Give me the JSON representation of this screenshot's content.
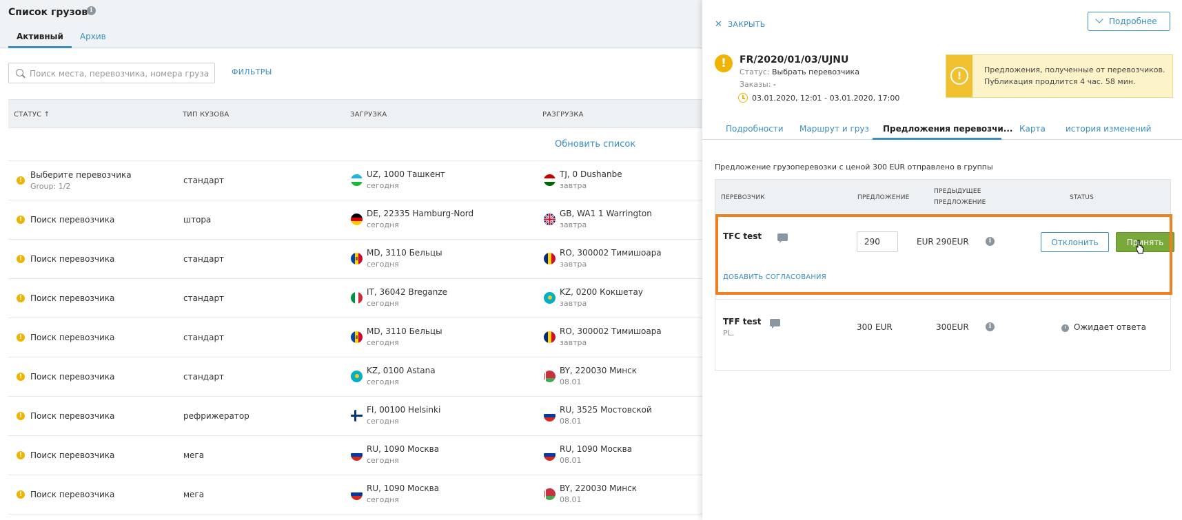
{
  "page": {
    "title": "Список грузов",
    "tabs": [
      {
        "label": "Активный",
        "active": true
      },
      {
        "label": "Архив",
        "active": false
      }
    ],
    "search_placeholder": "Поиск места, перевозчика, номера груза ...",
    "filters_label": "ФИЛЬТРЫ",
    "refresh_label": "Обновить список",
    "columns": {
      "status": "СТАТУС ↑",
      "body_type": "ТИП КУЗОВА",
      "loading": "ЗАГРУЗКА",
      "unloading": "РАЗГРУЗКА"
    },
    "rows": [
      {
        "status": "Выберите перевозчика",
        "status_sub": "Group: 1/2",
        "body": "стандарт",
        "load": "UZ, 1000 Ташкент",
        "load_day": "сегодня",
        "load_flag": "uz",
        "unload": "TJ, 0 Dushanbe",
        "unload_day": "завтра",
        "unload_flag": "tj"
      },
      {
        "status": "Поиск перевозчика",
        "status_sub": "",
        "body": "штора",
        "load": "DE, 22335 Hamburg-Nord",
        "load_day": "сегодня",
        "load_flag": "de",
        "unload": "GB, WA1 1 Warrington",
        "unload_day": "завтра",
        "unload_flag": "gb"
      },
      {
        "status": "Поиск перевозчика",
        "status_sub": "",
        "body": "стандарт",
        "load": "MD, 3110 Бельцы",
        "load_day": "сегодня",
        "load_flag": "md",
        "unload": "RO, 300002 Тимишоара",
        "unload_day": "завтра",
        "unload_flag": "ro"
      },
      {
        "status": "Поиск перевозчика",
        "status_sub": "",
        "body": "стандарт",
        "load": "IT, 36042 Breganze",
        "load_day": "сегодня",
        "load_flag": "it",
        "unload": "KZ, 0200 Кокшетау",
        "unload_day": "завтра",
        "unload_flag": "kz"
      },
      {
        "status": "Поиск перевозчика",
        "status_sub": "",
        "body": "стандарт",
        "load": "MD, 3110 Бельцы",
        "load_day": "сегодня",
        "load_flag": "md",
        "unload": "RO, 300002 Тимишоара",
        "unload_day": "завтра",
        "unload_flag": "ro"
      },
      {
        "status": "Поиск перевозчика",
        "status_sub": "",
        "body": "стандарт",
        "load": "KZ, 0100 Astana",
        "load_day": "сегодня",
        "load_flag": "kz",
        "unload": "BY, 220030 Минск",
        "unload_day": "08.01",
        "unload_flag": "by"
      },
      {
        "status": "Поиск перевозчика",
        "status_sub": "",
        "body": "рефрижератор",
        "load": "FI, 00100 Helsinki",
        "load_day": "сегодня",
        "load_flag": "fi",
        "unload": "RU, 3525 Мостовской",
        "unload_day": "08.01",
        "unload_flag": "ru"
      },
      {
        "status": "Поиск перевозчика",
        "status_sub": "",
        "body": "мега",
        "load": "RU, 1090 Москва",
        "load_day": "сегодня",
        "load_flag": "ru",
        "unload": "RU, 1090 Москва",
        "unload_day": "08.01",
        "unload_flag": "ru"
      },
      {
        "status": "Поиск перевозчика",
        "status_sub": "",
        "body": "мега",
        "load": "RU, 1090 Москва",
        "load_day": "сегодня",
        "load_flag": "ru",
        "unload": "BY, 220030 Минск",
        "unload_day": "08.01",
        "unload_flag": "by"
      }
    ]
  },
  "panel": {
    "close_label": "ЗАКРЫТЬ",
    "more_label": "Подробнее",
    "cargo_id": "FR/2020/01/03/UJNU",
    "status_key": "Статус:",
    "status_value": "Выбрать перевозчика",
    "orders_key": "Заказы:",
    "orders_value": "-",
    "dates": "03.01.2020, 12:01 - 03.01.2020, 17:00",
    "notice_line1": "Предложения, полученные от перевозчиков.",
    "notice_line2": "Публикация продлится 4 час. 58 мин.",
    "tabs": [
      "Подробности",
      "Маршрут и груз",
      "Предложения перевозчи...",
      "Карта",
      "история изменений"
    ],
    "offer_info": "Предложение грузоперевозки с ценой 300 EUR отправлено в группы",
    "columns": {
      "carrier": "ПЕРЕВОЗЧИК",
      "offer": "ПРЕДЛОЖЕНИЕ",
      "prev_offer_1": "ПРЕДЫДУЩЕЕ",
      "prev_offer_2": "ПРЕДЛОЖЕНИЕ",
      "status": "STATUS"
    },
    "offers": [
      {
        "carrier": "TFC test",
        "offer_value": "290",
        "currency": "EUR",
        "prev_value": "290",
        "prev_currency": "EUR",
        "reject_label": "Отклонить",
        "accept_label": "Принять",
        "add_label": "ДОБАВИТЬ СОГЛАСОВАНИЯ"
      },
      {
        "carrier": "TFF test",
        "sub": "PL,",
        "offer_value": "300",
        "currency": "EUR",
        "prev_value": "300",
        "prev_currency": "EUR",
        "status": "Ожидает ответа"
      }
    ]
  },
  "colors": {
    "accent": "#3a8fc0",
    "warning": "#f0b400",
    "accept": "#79a83b",
    "highlight": "#f07f22"
  }
}
